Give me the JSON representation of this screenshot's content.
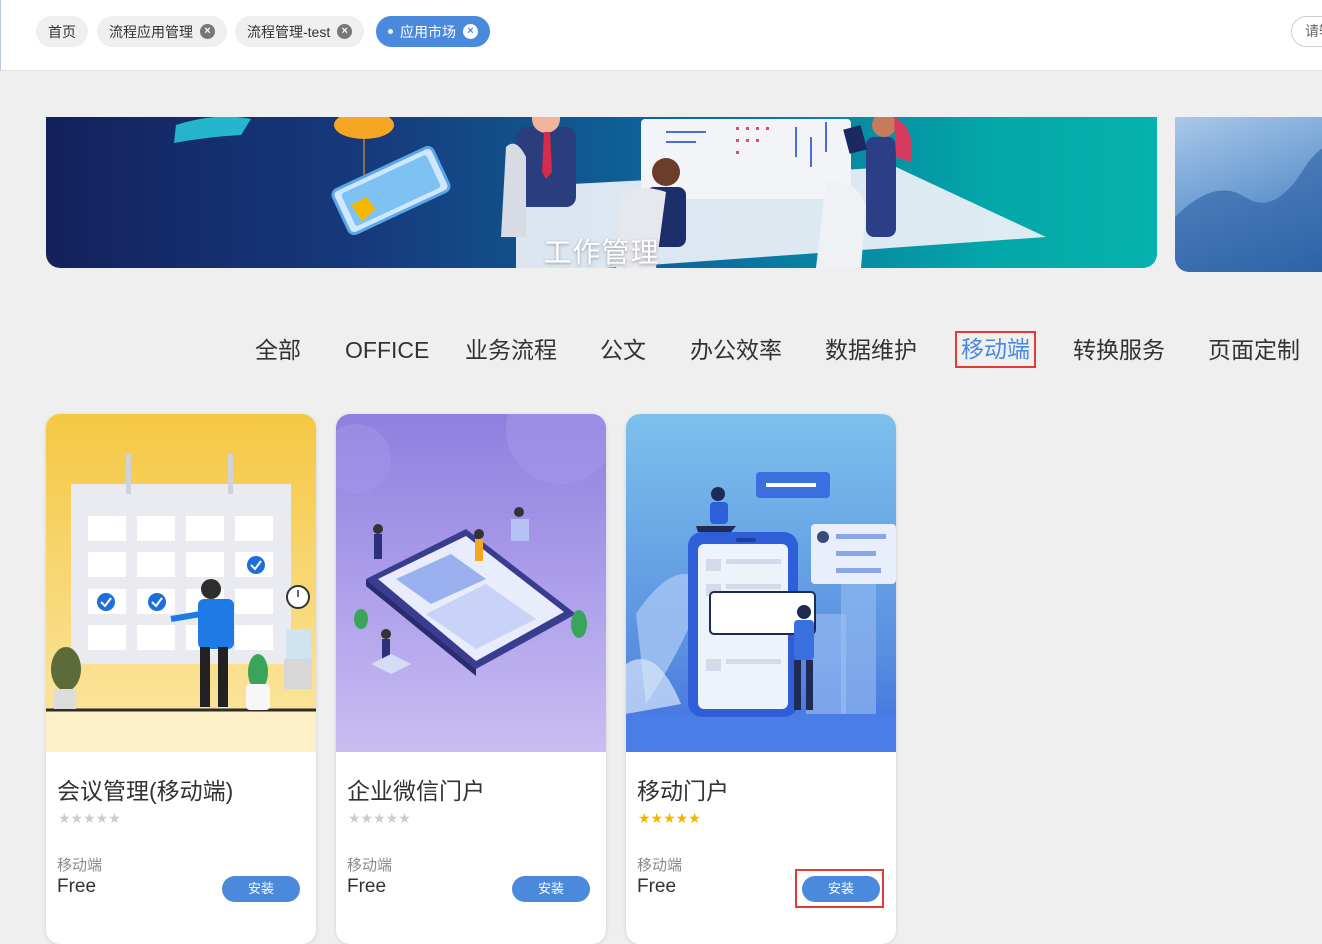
{
  "tabs": [
    {
      "label": "首页",
      "closable": false,
      "active": false
    },
    {
      "label": "流程应用管理",
      "closable": true,
      "active": false
    },
    {
      "label": "流程管理-test",
      "closable": true,
      "active": false
    },
    {
      "label": "应用市场",
      "closable": true,
      "active": true
    }
  ],
  "header": {
    "search_placeholder": "请输"
  },
  "banner": {
    "title": "工作管理"
  },
  "categories": [
    "全部",
    "OFFICE",
    "业务流程",
    "公文",
    "办公效率",
    "数据维护",
    "移动端",
    "转换服务",
    "页面定制"
  ],
  "selected_category": "移动端",
  "cards": [
    {
      "title": "会议管理(移动端)",
      "rating": 0,
      "stars": "★★★★★",
      "category": "移动端",
      "price": "Free",
      "install_label": "安装"
    },
    {
      "title": "企业微信门户",
      "rating": 0,
      "stars": "★★★★★",
      "category": "移动端",
      "price": "Free",
      "install_label": "安装"
    },
    {
      "title": "移动门户",
      "rating": 5,
      "stars": "★★★★★",
      "category": "移动端",
      "price": "Free",
      "install_label": "安装"
    }
  ],
  "colors": {
    "accent": "#4a89dc",
    "highlight": "#e53935",
    "star_filled": "#f5b400",
    "star_empty": "#cccccc"
  },
  "icons": {
    "close": "close-circle-icon",
    "active_dot": "dot-icon"
  }
}
